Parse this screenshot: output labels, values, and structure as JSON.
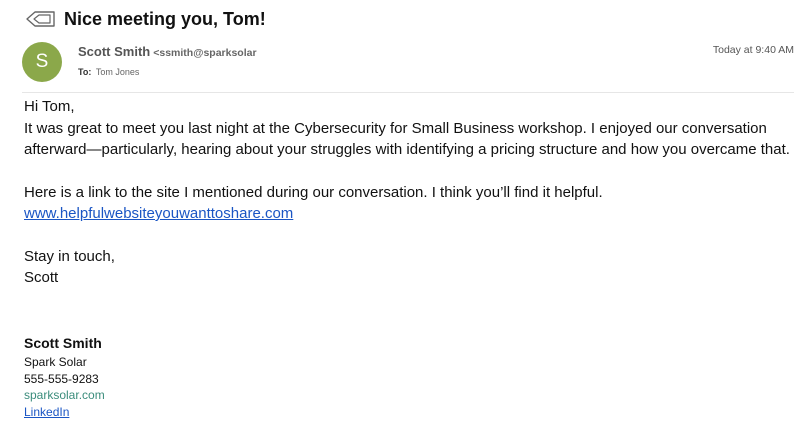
{
  "email": {
    "subject": "Nice meeting you, Tom!",
    "from_name": "Scott Smith",
    "from_email": "<ssmith@sparksolar",
    "avatar_initial": "S",
    "date": "Today at 9:40 AM",
    "to_label": "To:",
    "to_value": "Tom Jones"
  },
  "body": {
    "greeting": "Hi Tom,",
    "para1": "It was great to meet you last night at the Cybersecurity for Small Business workshop. I enjoyed our conversation afterward—particularly, hearing about your struggles with identifying a pricing structure and how you overcame that.",
    "para2": "Here is a link to the site I mentioned during our conversation. I think you’ll find it helpful.",
    "link": "www.helpfulwebsiteyouwanttoshare.com",
    "closing": "Stay in touch,",
    "sender_first": "Scott"
  },
  "signature": {
    "name": "Scott Smith",
    "company": "Spark Solar",
    "phone": "555-555-9283",
    "website": "sparksolar.com",
    "linkedin": "LinkedIn"
  },
  "colors": {
    "avatar": "#8ba84a",
    "link": "#1a55c4",
    "website": "#3b8d7c"
  },
  "icons": {
    "subject_icon": "tag-icon"
  }
}
